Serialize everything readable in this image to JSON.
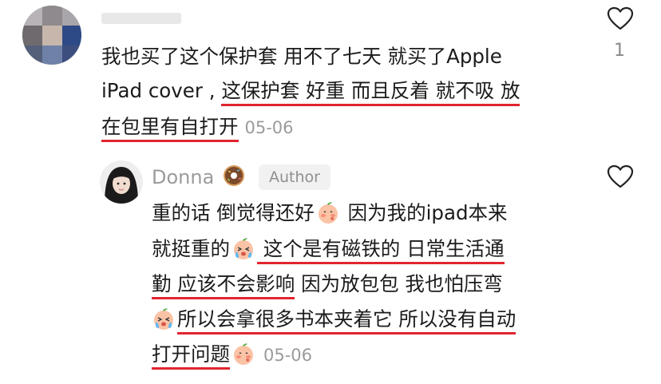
{
  "comment": {
    "username": "",
    "like_count": "1",
    "lines": [
      [
        {
          "t": "我也买了这个保护套 用不了七天 就买了Apple",
          "u": false
        }
      ],
      [
        {
          "t": "iPad cover , ",
          "u": false
        },
        {
          "t": "这保护套 好重 而且反着 就不吸 放",
          "u": true
        }
      ],
      [
        {
          "t": "在包里有自打开",
          "u": true
        }
      ]
    ],
    "date": "05-06"
  },
  "reply": {
    "username": "Donna",
    "badge": "Author",
    "line1a": "重的话 倒觉得还好",
    "line1b": " 因为我的ipad本来",
    "line2a": "就挺重的",
    "line2b": " 这个是有磁铁的 日常生活通",
    "line3a": "勤 应该不会影响",
    "line3b": " 因为放包包 我也怕压弯",
    "line4": "所以会拿很多书本夹着它 所以没有自动",
    "line5": "打开问题",
    "date": "05-06"
  },
  "icons": {
    "like": "heart-outline-icon",
    "donut": "donut-emoji-icon",
    "peach": "peach-emoji-icon",
    "crying": "crying-peach-emoji-icon"
  },
  "colors": {
    "underline": "#e1252f",
    "muted": "#9b9b9b"
  }
}
